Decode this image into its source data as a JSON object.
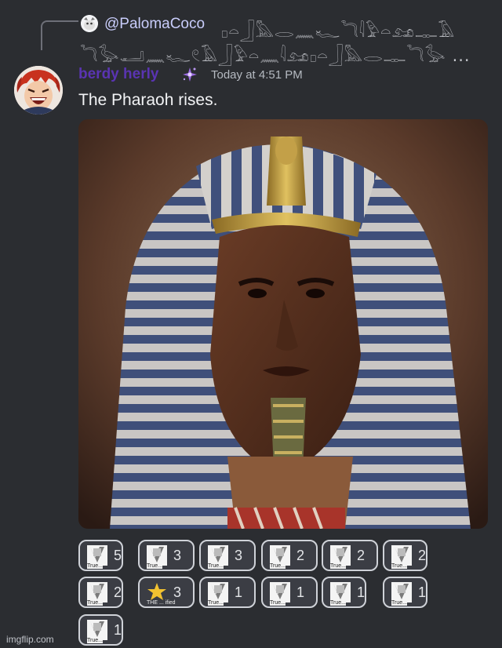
{
  "reply": {
    "author": "@PalomaCoco",
    "text_line1": "𓊪𓏏𓃀𓅓𓂋𓈖𓆑𓆓𓇋𓅱𓏏𓃭𓊃𓄿",
    "text_line2": "𓆓𓅭𓂝𓈖𓆑𓏲𓄿𓃀𓅱𓏏𓈖𓇋𓃭𓊪𓏏𓃀𓅓𓂋𓊃𓆓𓅭 ..."
  },
  "message": {
    "username": "berdy herly",
    "timestamp": "Today at 4:51 PM",
    "content": "The Pharaoh rises."
  },
  "reactions": [
    {
      "emoji": "true-emoji",
      "label": "True...",
      "count": "5"
    },
    {
      "emoji": "true-emoji",
      "label": "True...",
      "count": "3"
    },
    {
      "emoji": "true-emoji",
      "label": "True...",
      "count": "3"
    },
    {
      "emoji": "true-emoji",
      "label": "True...",
      "count": "2"
    },
    {
      "emoji": "true-emoji",
      "label": "True...",
      "count": "2"
    },
    {
      "emoji": "true-emoji",
      "label": "True...",
      "count": "2"
    },
    {
      "emoji": "true-emoji",
      "label": "True...",
      "count": "2"
    },
    {
      "emoji": "star-emoji",
      "label": "THE ... ified",
      "count": "3"
    },
    {
      "emoji": "true-emoji",
      "label": "True...",
      "count": "1"
    },
    {
      "emoji": "true-emoji",
      "label": "True...",
      "count": "1"
    },
    {
      "emoji": "true-emoji",
      "label": "True...",
      "count": "1"
    },
    {
      "emoji": "true-emoji",
      "label": "True...",
      "count": "1"
    },
    {
      "emoji": "true-emoji",
      "label": "True...",
      "count": "1"
    }
  ],
  "watermark": "imgflip.com",
  "colors": {
    "background": "#2b2d31",
    "username": "#5a34b2",
    "mention": "#c9cdfb"
  }
}
